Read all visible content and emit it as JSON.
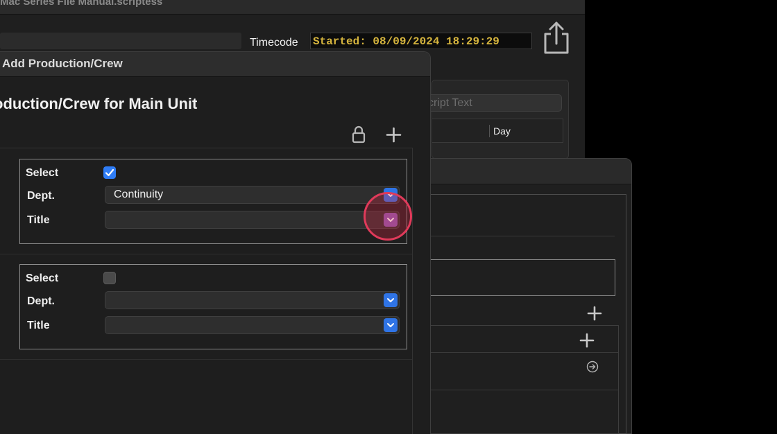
{
  "main_window": {
    "title": "Mac Series File Manual.scriptess",
    "timecode_label": "Timecode",
    "timecode_value": "Started: 08/09/2024 18:29:29",
    "script_search_placeholder": "cript Text",
    "columns": [
      "Day"
    ]
  },
  "sheet": {
    "title": "Add Production/Crew",
    "heading": "oduction/Crew for Main Unit",
    "entries": [
      {
        "select_label": "Select",
        "selected": true,
        "dept_label": "Dept.",
        "dept_value": "Continuity",
        "title_label": "Title",
        "title_value": ""
      },
      {
        "select_label": "Select",
        "selected": false,
        "dept_label": "Dept.",
        "dept_value": "",
        "title_label": "Title",
        "title_value": ""
      }
    ]
  },
  "colors": {
    "accent": "#2f7df6",
    "timecode": "#d6b53e",
    "click_indicator": "#e03a5a"
  },
  "icons": {
    "share": "share-icon",
    "lock": "lock-icon",
    "add": "plus-icon",
    "circle_arrow": "circle-arrow-icon",
    "popup": "chevron-down-icon",
    "check": "checkmark-icon"
  }
}
